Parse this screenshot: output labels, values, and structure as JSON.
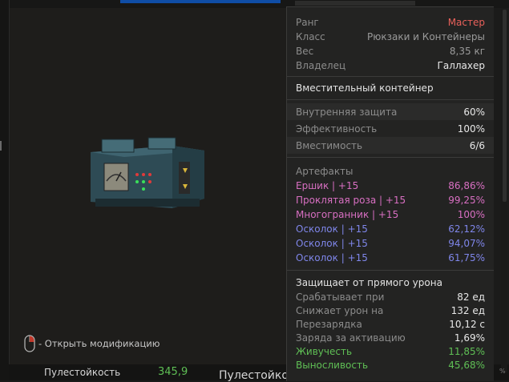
{
  "item": {
    "stats": [
      {
        "label": "Ранг",
        "value": "Мастер",
        "color": "#e8605a"
      },
      {
        "label": "Класс",
        "value": "Рюкзаки и Контейнеры",
        "color": "#9a9a9a"
      },
      {
        "label": "Вес",
        "value": "8,35 кг",
        "color": "#9a9a9a"
      },
      {
        "label": "Владелец",
        "value": "Галлахер",
        "color": "#e8e8e8"
      }
    ],
    "type": "Вместительный контейнер",
    "container": [
      {
        "label": "Внутренняя защита",
        "value": "60%"
      },
      {
        "label": "Эффективность",
        "value": "100%"
      },
      {
        "label": "Вместимость",
        "value": "6/6"
      }
    ]
  },
  "artifacts": {
    "title": "Артефакты",
    "items": [
      {
        "label": "Ершик | +15",
        "value": "86,86%",
        "color": "#d86fc2"
      },
      {
        "label": "Проклятая роза | +15",
        "value": "99,25%",
        "color": "#d86fc2"
      },
      {
        "label": "Многогранник | +15",
        "value": "100%",
        "color": "#d86fc2"
      },
      {
        "label": "Осколок | +15",
        "value": "62,12%",
        "color": "#7f86ea"
      },
      {
        "label": "Осколок | +15",
        "value": "94,07%",
        "color": "#7f86ea"
      },
      {
        "label": "Осколок | +15",
        "value": "61,75%",
        "color": "#7f86ea"
      }
    ]
  },
  "protection": {
    "title": "Защищает от прямого урона",
    "rows": [
      {
        "label": "Срабатывает при",
        "value": "82 ед"
      },
      {
        "label": "Снижает урон на",
        "value": "132 ед"
      },
      {
        "label": "Перезарядка",
        "value": "10,12 с"
      },
      {
        "label": "Заряда за активацию",
        "value": "1,69%"
      }
    ],
    "bonuses": [
      {
        "label": "Живучесть",
        "value": "11,85%",
        "color": "#5fbf55"
      },
      {
        "label": "Выносливость",
        "value": "45,68%",
        "color": "#5fbf55"
      }
    ]
  },
  "hint": {
    "text": "- Открыть модификацию"
  },
  "bottom": {
    "stat_label": "Пулестойкость",
    "stat_value": "345,9",
    "stat_label_2": "Пулестойкость"
  },
  "edge": {
    "text": "%"
  }
}
